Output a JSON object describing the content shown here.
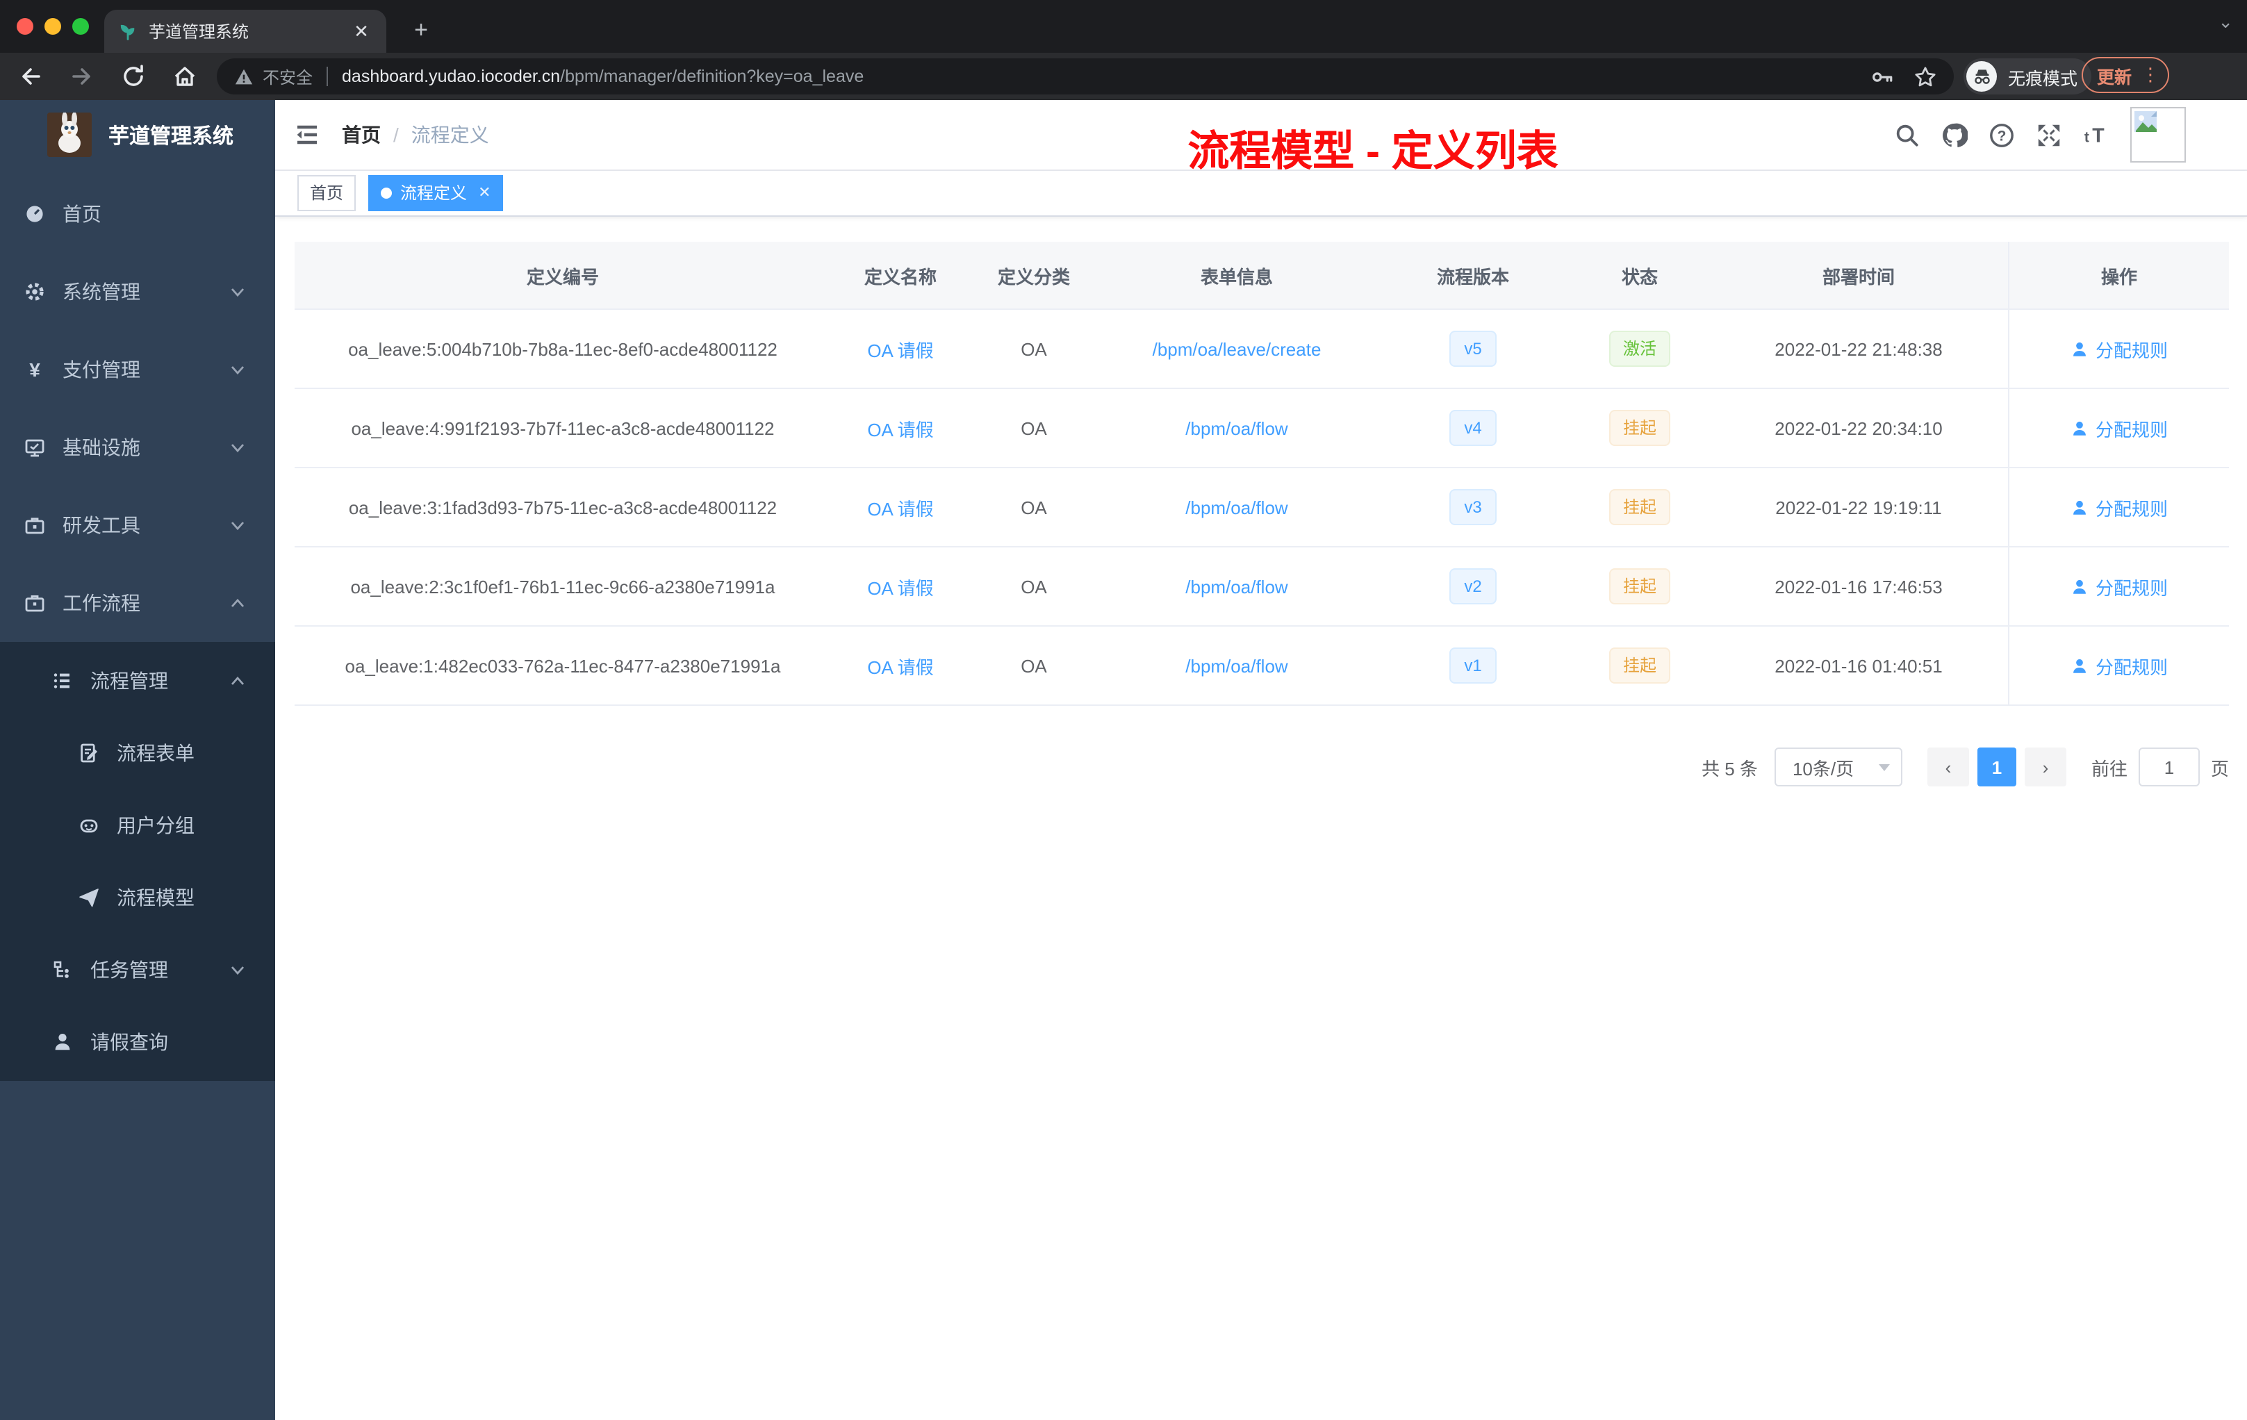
{
  "browser": {
    "tab_title": "芋道管理系统",
    "security_label": "不安全",
    "url_host": "dashboard.yudao.iocoder.cn",
    "url_path": "/bpm/manager/definition?key=oa_leave",
    "incognito_label": "无痕模式",
    "update_label": "更新"
  },
  "sidebar": {
    "logo_title": "芋道管理系统",
    "items": [
      {
        "key": "home",
        "label": "首页",
        "icon": "dashboard-icon",
        "expandable": false
      },
      {
        "key": "system",
        "label": "系统管理",
        "icon": "gear-icon",
        "expandable": true,
        "expanded": false
      },
      {
        "key": "payment",
        "label": "支付管理",
        "icon": "yen-icon",
        "expandable": true,
        "expanded": false
      },
      {
        "key": "infra",
        "label": "基础设施",
        "icon": "monitor-icon",
        "expandable": true,
        "expanded": false
      },
      {
        "key": "devtools",
        "label": "研发工具",
        "icon": "toolbox-icon",
        "expandable": true,
        "expanded": false
      },
      {
        "key": "workflow",
        "label": "工作流程",
        "icon": "briefcase-icon",
        "expandable": true,
        "expanded": true
      }
    ],
    "submenu": [
      {
        "key": "process-management",
        "label": "流程管理",
        "icon": "list-icon",
        "level": 1,
        "expandable": true,
        "expanded": true
      },
      {
        "key": "process-form",
        "label": "流程表单",
        "icon": "form-icon",
        "level": 2,
        "expandable": false
      },
      {
        "key": "user-group",
        "label": "用户分组",
        "icon": "robot-icon",
        "level": 2,
        "expandable": false
      },
      {
        "key": "process-model",
        "label": "流程模型",
        "icon": "paper-plane-icon",
        "level": 2,
        "expandable": false
      },
      {
        "key": "task-management",
        "label": "任务管理",
        "icon": "tree-icon",
        "level": 1,
        "expandable": true,
        "expanded": false
      },
      {
        "key": "leave-query",
        "label": "请假查询",
        "icon": "user-icon",
        "level": 1,
        "expandable": false
      }
    ]
  },
  "header": {
    "breadcrumb_home": "首页",
    "breadcrumb_separator": "/",
    "breadcrumb_current": "流程定义",
    "annotation": "流程模型 - 定义列表"
  },
  "tags": [
    {
      "label": "首页",
      "active": false,
      "closable": false
    },
    {
      "label": "流程定义",
      "active": true,
      "closable": true
    }
  ],
  "table": {
    "columns": [
      "定义编号",
      "定义名称",
      "定义分类",
      "表单信息",
      "流程版本",
      "状态",
      "部署时间",
      "操作"
    ],
    "rows": [
      {
        "id": "oa_leave:5:004b710b-7b8a-11ec-8ef0-acde48001122",
        "name": "OA 请假",
        "category": "OA",
        "form": "/bpm/oa/leave/create",
        "version": "v5",
        "status": "激活",
        "status_type": "success",
        "time": "2022-01-22 21:48:38",
        "action": "分配规则"
      },
      {
        "id": "oa_leave:4:991f2193-7b7f-11ec-a3c8-acde48001122",
        "name": "OA 请假",
        "category": "OA",
        "form": "/bpm/oa/flow",
        "version": "v4",
        "status": "挂起",
        "status_type": "warning",
        "time": "2022-01-22 20:34:10",
        "action": "分配规则"
      },
      {
        "id": "oa_leave:3:1fad3d93-7b75-11ec-a3c8-acde48001122",
        "name": "OA 请假",
        "category": "OA",
        "form": "/bpm/oa/flow",
        "version": "v3",
        "status": "挂起",
        "status_type": "warning",
        "time": "2022-01-22 19:19:11",
        "action": "分配规则"
      },
      {
        "id": "oa_leave:2:3c1f0ef1-76b1-11ec-9c66-a2380e71991a",
        "name": "OA 请假",
        "category": "OA",
        "form": "/bpm/oa/flow",
        "version": "v2",
        "status": "挂起",
        "status_type": "warning",
        "time": "2022-01-16 17:46:53",
        "action": "分配规则"
      },
      {
        "id": "oa_leave:1:482ec033-762a-11ec-8477-a2380e71991a",
        "name": "OA 请假",
        "category": "OA",
        "form": "/bpm/oa/flow",
        "version": "v1",
        "status": "挂起",
        "status_type": "warning",
        "time": "2022-01-16 01:40:51",
        "action": "分配规则"
      }
    ]
  },
  "pagination": {
    "total_label": "共 5 条",
    "page_size_label": "10条/页",
    "prev_label": "‹",
    "current_page": "1",
    "next_label": "›",
    "goto_label": "前往",
    "goto_value": "1",
    "unit_label": "页"
  },
  "colors": {
    "accent": "#409eff",
    "success": "#67c23a",
    "warning": "#e6a23c",
    "annotation_red": "#fb0d0d",
    "sidebar_bg": "#304156",
    "submenu_bg": "#1f2d3d",
    "table_header_bg": "#f6f7f9"
  }
}
